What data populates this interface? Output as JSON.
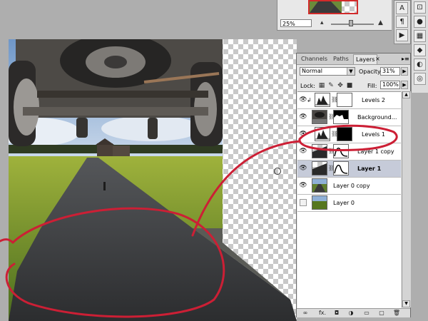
{
  "navigator": {
    "zoom": "25%",
    "thumb_border_color": "#d12a2a"
  },
  "right_toolbar": {
    "items": [
      {
        "icon": "character-a-icon",
        "glyph": "A"
      },
      {
        "icon": "paragraph-icon",
        "glyph": "¶"
      },
      {
        "icon": "actions-play-icon",
        "glyph": "▶"
      },
      {
        "icon": "history-icon",
        "glyph": "⊡"
      }
    ],
    "items2": [
      {
        "icon": "color-icon",
        "glyph": "●"
      },
      {
        "icon": "swatches-icon",
        "glyph": "▦"
      },
      {
        "icon": "styles-icon",
        "glyph": "◆"
      },
      {
        "icon": "adjustments-icon",
        "glyph": "◐"
      },
      {
        "icon": "masks-icon",
        "glyph": "◎"
      },
      {
        "icon": "layers-icon",
        "glyph": "◈"
      }
    ]
  },
  "layers_panel": {
    "tabs": [
      {
        "label": "Channels",
        "active": false
      },
      {
        "label": "Paths",
        "active": false
      },
      {
        "label": "Layers",
        "active": true
      }
    ],
    "close_glyph": "×",
    "menu_glyph": "▸≡",
    "blend_mode": "Normal",
    "opacity_label": "Opacity:",
    "opacity_value": "31%",
    "lock_label": "Lock:",
    "fill_label": "Fill:",
    "fill_value": "100%",
    "layers": [
      {
        "name": "Levels 2",
        "visible": true,
        "clipped": true,
        "thumb": "levels",
        "mask": "white",
        "selected": false
      },
      {
        "name": "Background...",
        "visible": true,
        "clipped": false,
        "thumb": "photo-dark",
        "mask": "black-shape",
        "selected": false
      },
      {
        "name": "Levels 1",
        "visible": true,
        "clipped": false,
        "thumb": "levels",
        "mask": "black",
        "selected": false
      },
      {
        "name": "Layer 1 copy",
        "visible": true,
        "clipped": false,
        "thumb": "gradient",
        "mask": "curve",
        "selected": false
      },
      {
        "name": "Layer 1",
        "visible": true,
        "clipped": false,
        "thumb": "gradient",
        "mask": "curve",
        "selected": true
      },
      {
        "name": "Layer 0 copy",
        "visible": true,
        "clipped": false,
        "thumb": "field",
        "mask": "none",
        "selected": false
      },
      {
        "name": "Layer 0",
        "visible": false,
        "clipped": false,
        "thumb": "field",
        "mask": "none",
        "selected": false
      }
    ],
    "footer_icons": [
      "link-layers-icon",
      "fx-icon",
      "add-mask-icon",
      "adjustment-layer-icon",
      "new-group-icon",
      "new-layer-icon",
      "delete-layer-icon"
    ],
    "footer_glyphs": [
      "∞",
      "fx.",
      "◘",
      "◑",
      "▭",
      "▢",
      "🗑"
    ]
  },
  "annotation_color": "#cc1f35"
}
